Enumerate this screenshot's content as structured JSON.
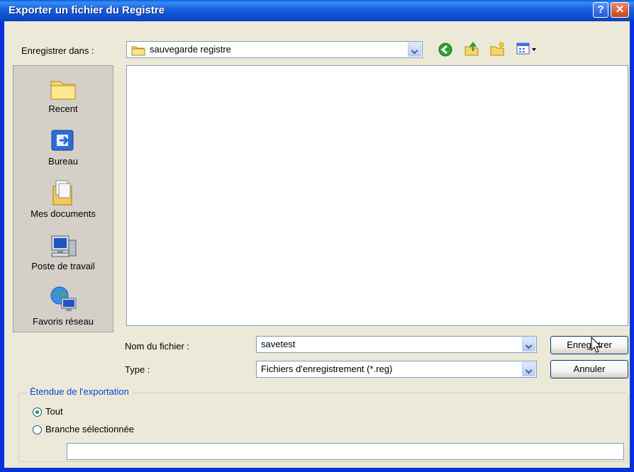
{
  "window": {
    "title": "Exporter un fichier du Registre",
    "help_glyph": "?",
    "close_glyph": "✕"
  },
  "toolbar": {
    "save_in_label": "Enregistrer dans :",
    "save_in_value": "sauvegarde registre",
    "icons": [
      "back-icon",
      "up-folder-icon",
      "new-folder-icon",
      "view-menu-icon"
    ]
  },
  "places": [
    {
      "label": "Recent",
      "icon": "recent-folder-icon"
    },
    {
      "label": "Bureau",
      "icon": "desktop-icon"
    },
    {
      "label": "Mes documents",
      "icon": "my-documents-icon"
    },
    {
      "label": "Poste de travail",
      "icon": "my-computer-icon"
    },
    {
      "label": "Favoris réseau",
      "icon": "network-places-icon"
    }
  ],
  "form": {
    "filename_label": "Nom du fichier :",
    "filename_value": "savetest",
    "type_label": "Type :",
    "type_value": "Fichiers d'enregistrement (*.reg)",
    "save_button": "Enregistrer",
    "cancel_button": "Annuler"
  },
  "export_range": {
    "legend": "Étendue de l'exportation",
    "all_label": "Tout",
    "branch_label": "Branche sélectionnée",
    "selected": "all",
    "branch_value": ""
  }
}
